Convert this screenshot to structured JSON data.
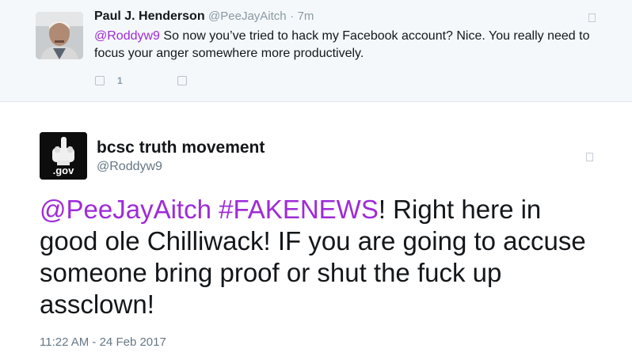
{
  "parent_tweet": {
    "author_name": "Paul J. Henderson",
    "author_handle": "@PeeJayAitch",
    "time": "7m",
    "separator": "·",
    "mention": "@Roddyw9",
    "text": " So now you’ve tried to hack my Facebook account? Nice. You really need to focus your anger somewhere more productively.",
    "reply_count": "1"
  },
  "main_tweet": {
    "author_name": "bcsc truth movement",
    "author_handle": "@Roddyw9",
    "avatar_label": ".gov",
    "mention": "@PeeJayAitch",
    "hashtag": "#FAKENEWS",
    "text": "!  Right here in good ole Chilliwack!   IF you are going to accuse someone bring proof or shut the fuck up assclown!",
    "timestamp": "11:22 AM - 24 Feb 2017"
  },
  "colors": {
    "accent": "#9e2bd8",
    "muted": "#657786",
    "parent_bg": "#f5f8fa"
  },
  "icons": [
    "reply-icon",
    "like-icon",
    "more-options-icon"
  ]
}
